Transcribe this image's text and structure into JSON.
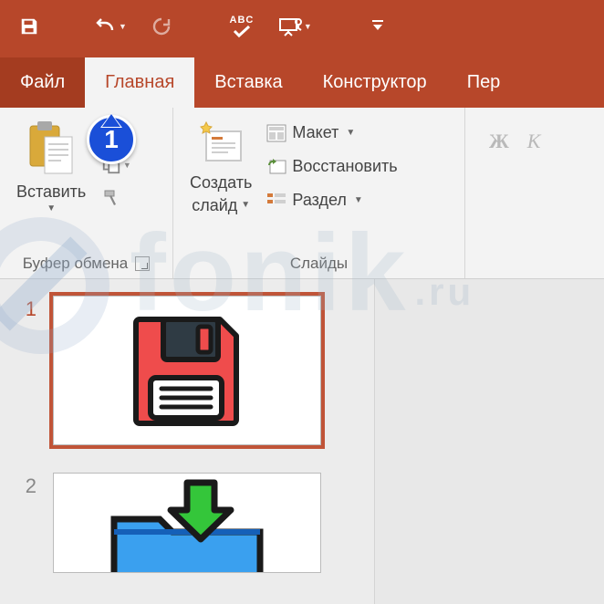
{
  "qat": {
    "save": "save",
    "undo": "undo",
    "redo": "redo",
    "spell": "spellcheck",
    "present": "present-from-start",
    "customize": "customize"
  },
  "tabs": {
    "file": "Файл",
    "home": "Главная",
    "insert": "Вставка",
    "design": "Конструктор",
    "transitions": "Пер"
  },
  "ribbon": {
    "clipboard": {
      "paste": "Вставить",
      "label": "Буфер обмена"
    },
    "slides": {
      "newslide_line1": "Создать",
      "newslide_line2": "слайд",
      "layout": "Макет",
      "reset": "Восстановить",
      "section": "Раздел",
      "label": "Слайды"
    },
    "font": {
      "bold": "Ж",
      "italic": "К"
    }
  },
  "thumbs": {
    "n1": "1",
    "n2": "2"
  },
  "annotation": {
    "badge1": "1"
  },
  "watermark": {
    "text": "fonik",
    "suffix": ".ru"
  }
}
